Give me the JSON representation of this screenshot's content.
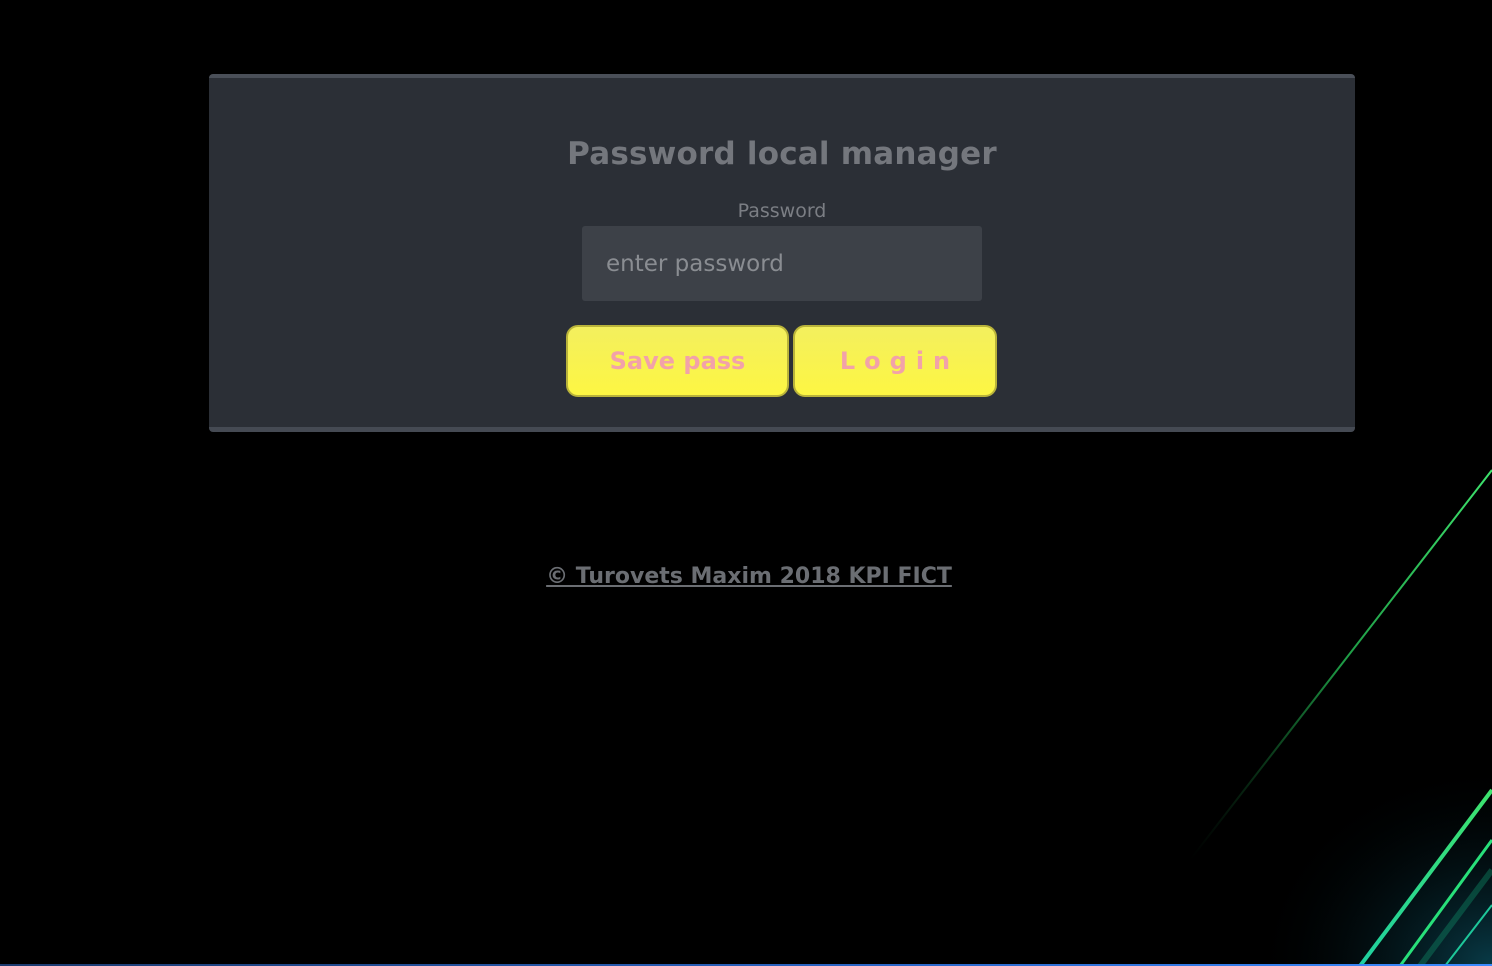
{
  "panel": {
    "title": "Password local manager",
    "password_label": "Password",
    "password_placeholder": "enter password",
    "password_value": ""
  },
  "buttons": {
    "save_label": "Save pass",
    "login_label": "Login"
  },
  "footer": {
    "text": "© Turovets Maxim 2018 KPI FICT"
  },
  "colors": {
    "background": "#000000",
    "panel": "#2b2f36",
    "button_fill": "#fdf643",
    "button_text": "#f2a2a9",
    "accent_lines": "#22d45a"
  }
}
